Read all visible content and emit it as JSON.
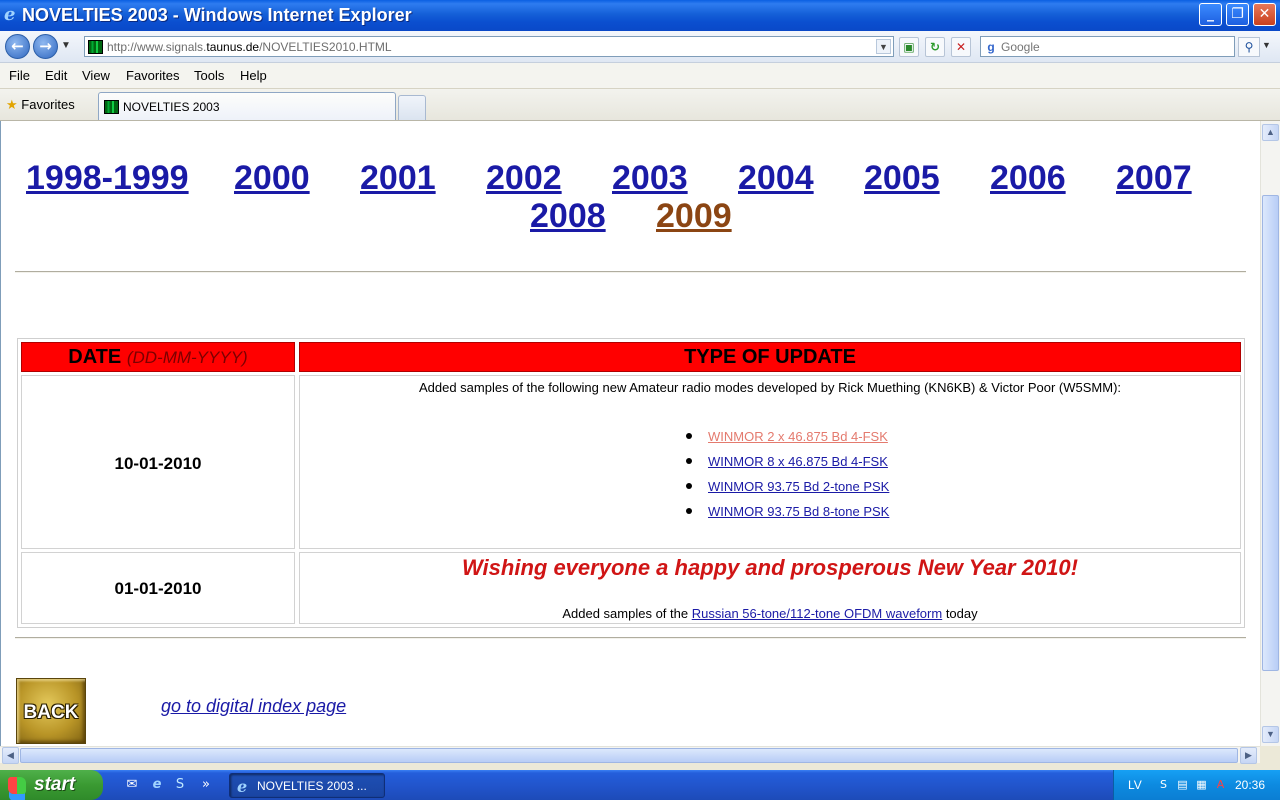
{
  "window": {
    "title": "NOVELTIES 2003 - Windows Internet Explorer",
    "buttons": {
      "minimize": "_",
      "maximize": "❐",
      "close": "✕"
    }
  },
  "address": {
    "url_prefix": "http://www.signals.",
    "url_host": "taunus.de",
    "url_path": "/NOVELTIES2010.HTML",
    "search_placeholder": "Google"
  },
  "menu": [
    "File",
    "Edit",
    "View",
    "Favorites",
    "Tools",
    "Help"
  ],
  "favorites_label": "Favorites",
  "tab": {
    "label": "NOVELTIES 2003"
  },
  "page": {
    "years": [
      "1998-1999",
      "2000",
      "2001",
      "2002",
      "2003",
      "2004",
      "2005",
      "2006",
      "2007",
      "2008",
      "2009"
    ],
    "visited_year": "2009",
    "table": {
      "header_date": "DATE",
      "header_date_format": "(DD-MM-YYYY)",
      "header_type": "TYPE OF UPDATE",
      "rows": [
        {
          "date": "10-01-2010",
          "intro": "Added samples of the following new Amateur radio modes developed by Rick Muething (KN6KB) & Victor Poor (W5SMM):",
          "links": [
            "WINMOR 2 x 46.875 Bd 4-FSK",
            "WINMOR 8 x 46.875 Bd 4-FSK",
            "WINMOR 93.75 Bd 2-tone PSK",
            "WINMOR 93.75 Bd 8-tone PSK"
          ]
        },
        {
          "date": "01-01-2010",
          "wish": "Wishing everyone a happy and prosperous New Year 2010!",
          "added_prefix": "Added samples of the ",
          "added_link": "Russian 56-tone/112-tone OFDM waveform",
          "added_suffix": " today"
        }
      ]
    },
    "back_label": "BACK",
    "index_link": "go to digital index page"
  },
  "taskbar": {
    "start_label": "start",
    "task_label": "NOVELTIES 2003 ...",
    "language": "LV",
    "clock": "20:36"
  },
  "colors": {
    "link": "#1a1aa6",
    "visited": "#8b4513",
    "header_red": "#ff0000",
    "wish_red": "#d01515"
  }
}
